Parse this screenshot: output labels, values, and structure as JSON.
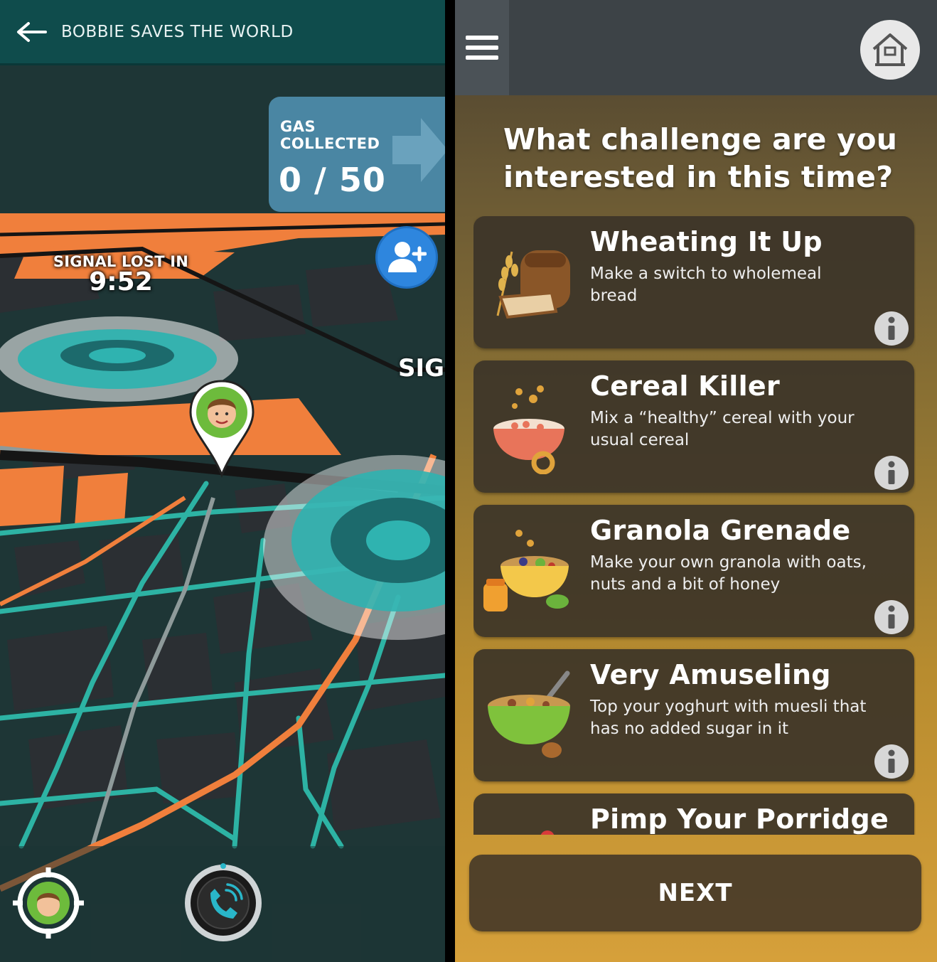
{
  "left_screen": {
    "header": {
      "title": "BOBBIE SAVES THE WORLD",
      "back_icon": "arrow-left-icon"
    },
    "gas": {
      "label": "GAS COLLECTED",
      "collected": "0 / 50"
    },
    "signal": {
      "label": "SIGNAL LOST IN",
      "time": "9:52"
    },
    "map_partial_label": "SIG",
    "icons": {
      "add_friend": "add-user-icon",
      "player": "player-avatar-pin-icon",
      "locate": "locate-player-icon",
      "call": "phone-call-icon"
    },
    "colors": {
      "header": "#0f4c4c",
      "gas_panel": "#4a86a3",
      "add_friend": "#2e86de",
      "map_orange": "#f07f3c",
      "map_teal": "#2db3a4"
    }
  },
  "right_screen": {
    "question": "What challenge are you interested in this time?",
    "icons": {
      "menu": "hamburger-menu-icon",
      "home": "home-icon",
      "info": "info-icon"
    },
    "challenges": [
      {
        "title": "Wheating It Up",
        "description": "Make a switch to wholemeal bread",
        "image": "bread-wheat-icon"
      },
      {
        "title": "Cereal Killer",
        "description": "Mix a “healthy” cereal with your usual cereal",
        "image": "cereal-bowl-icon"
      },
      {
        "title": "Granola Grenade",
        "description": "Make your own granola with oats, nuts and a bit of honey",
        "image": "granola-bowl-icon"
      },
      {
        "title": "Very Amuseling",
        "description": "Top your yoghurt with muesli that has no added sugar in it",
        "image": "muesli-bowl-icon"
      },
      {
        "title": "Pimp Your Porridge",
        "description": "",
        "image": "porridge-bowl-icon"
      }
    ],
    "next_label": "NEXT"
  }
}
